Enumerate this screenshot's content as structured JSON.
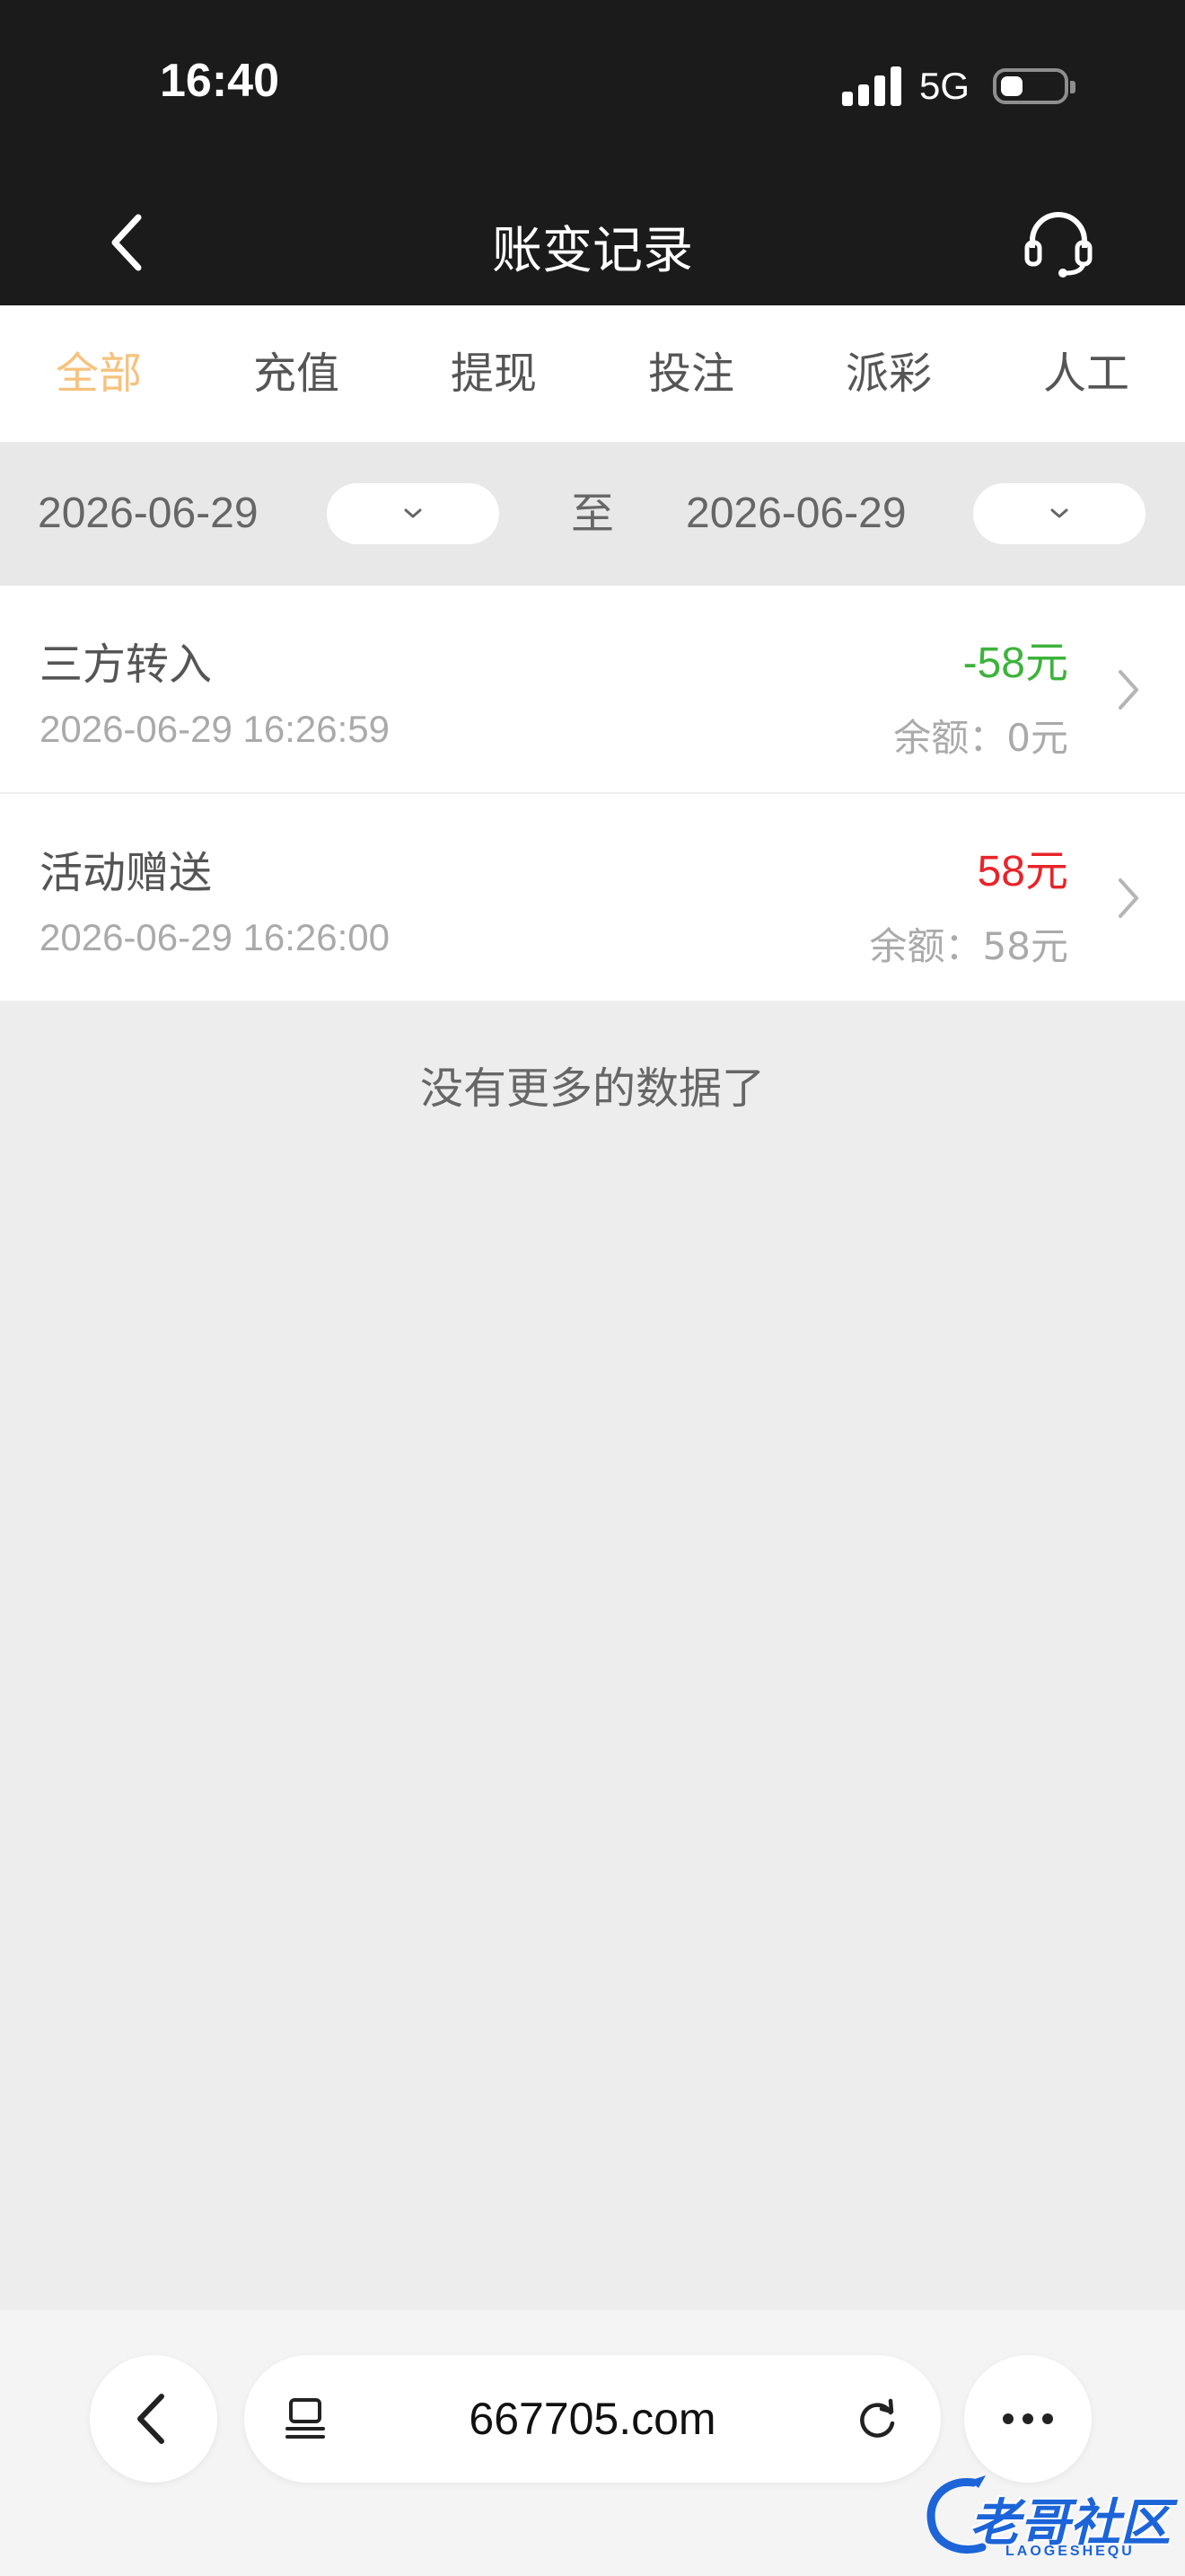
{
  "status_bar": {
    "time": "16:40",
    "network": "5G"
  },
  "nav": {
    "title": "账变记录"
  },
  "tabs": [
    {
      "label": "全部",
      "active": true
    },
    {
      "label": "充值",
      "active": false
    },
    {
      "label": "提现",
      "active": false
    },
    {
      "label": "投注",
      "active": false
    },
    {
      "label": "派彩",
      "active": false
    },
    {
      "label": "人工",
      "active": false
    }
  ],
  "filter": {
    "start_date": "2026-06-29",
    "to_label": "至",
    "end_date": "2026-06-29"
  },
  "records": [
    {
      "title": "三方转入",
      "time": "2026-06-29 16:26:59",
      "amount": "-58元",
      "balance": "余额：0元",
      "direction": "out"
    },
    {
      "title": "活动赠送",
      "time": "2026-06-29 16:26:00",
      "amount": "58元",
      "balance": "余额：58元",
      "direction": "in"
    }
  ],
  "no_more_text": "没有更多的数据了",
  "browser": {
    "url": "667705.com"
  },
  "watermark": {
    "text": "老哥社区",
    "sub": "LAOGESHEQU"
  },
  "colors": {
    "accent": "#f6c27d",
    "negative": "#3db33b",
    "positive": "#e8242a",
    "header_bg": "#1b1b1b"
  }
}
